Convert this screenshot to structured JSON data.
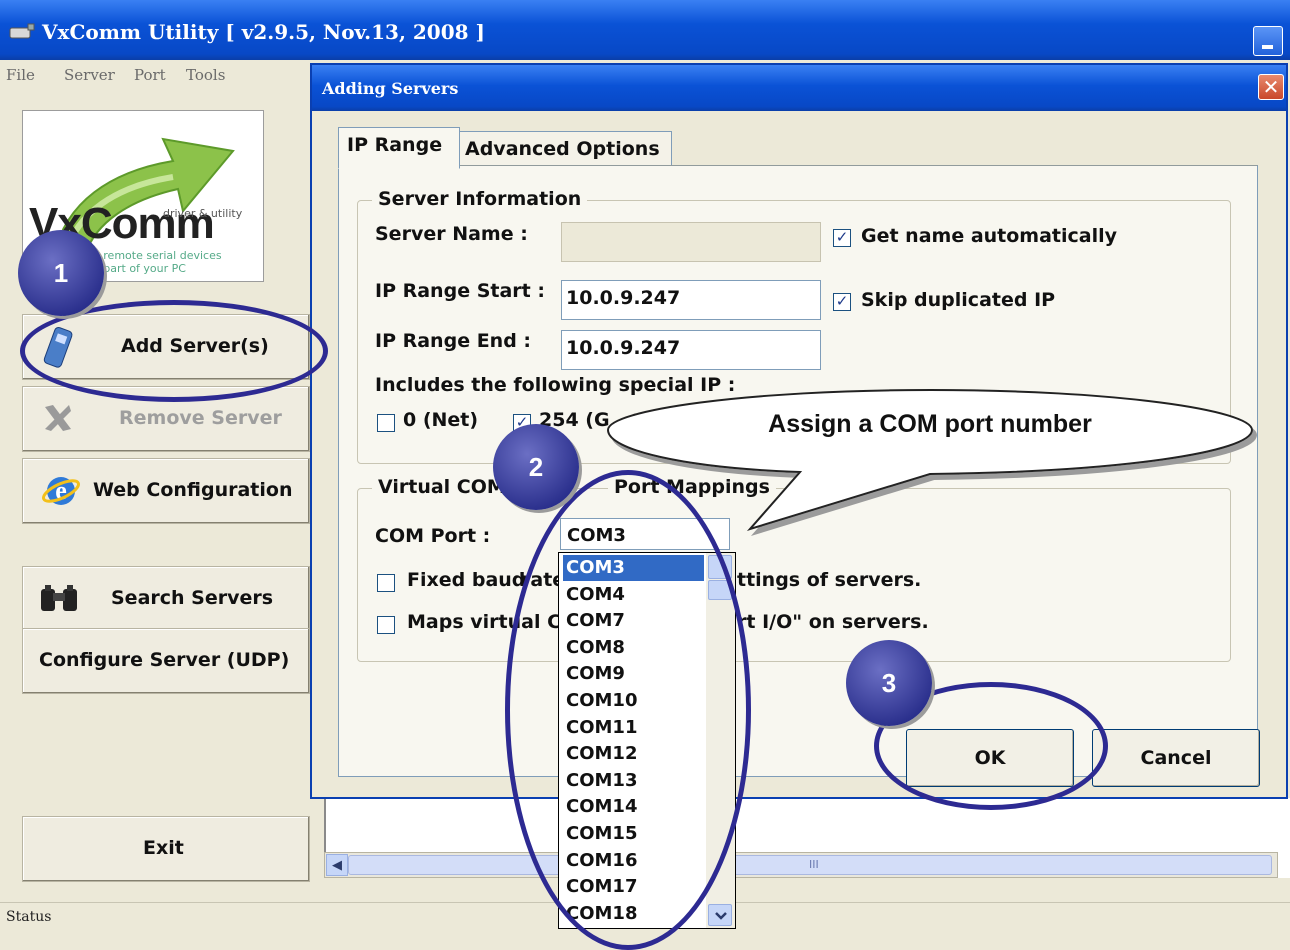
{
  "main_window": {
    "title": "VxComm Utility [ v2.9.5, Nov.13, 2008 ]",
    "menu": [
      "File",
      "Server",
      "Port",
      "Tools"
    ],
    "logo": {
      "brand": "VxComm",
      "tagline": "driver & utility",
      "subline1": "e remote serial devices",
      "subline2": "e part of your PC"
    },
    "buttons": {
      "add": "Add Server(s)",
      "remove": "Remove Server",
      "web": "Web Configuration",
      "search": "Search Servers",
      "configure": "Configure Server (UDP)",
      "exit": "Exit"
    },
    "scroll_mark": "III",
    "status": "Status"
  },
  "dialog": {
    "title": "Adding Servers",
    "tabs": [
      "IP Range",
      "Advanced Options"
    ],
    "server_info": {
      "legend": "Server Information",
      "server_name_label": "Server Name :",
      "server_name_value": "",
      "get_name_auto": {
        "label": "Get name automatically",
        "checked": true
      },
      "ip_start_label": "IP Range Start :",
      "ip_start_value": "10.0.9.247",
      "skip_dup": {
        "label": "Skip duplicated IP",
        "checked": true
      },
      "ip_end_label": "IP Range End :",
      "ip_end_value": "10.0.9.247",
      "special_ip_label": "Includes the following special IP :",
      "special_0": {
        "label": "0 (Net)",
        "checked": false
      },
      "special_254": {
        "label": "254 (G",
        "checked": true
      }
    },
    "mappings": {
      "legend_a": "Virtual COM",
      "legend_b": "Port Mappings",
      "com_port_label": "COM Port :",
      "com_port_value": "COM3",
      "fixed_baud_a": "Fixed baud",
      "fixed_baud_b": "rate",
      "fixed_baud_c": "ttings of servers.",
      "maps_a": "Maps virtual C",
      "maps_b": "rt I/O\" on servers."
    },
    "ok": "OK",
    "cancel": "Cancel"
  },
  "dropdown": {
    "items": [
      "COM3",
      "COM4",
      "COM7",
      "COM8",
      "COM9",
      "COM10",
      "COM11",
      "COM12",
      "COM13",
      "COM14",
      "COM15",
      "COM16",
      "COM17",
      "COM18"
    ],
    "selected": "COM3"
  },
  "annotations": {
    "step1": "1",
    "step2": "2",
    "step3": "3",
    "callout": "Assign a COM port number",
    "accent": "#2d2a92"
  }
}
